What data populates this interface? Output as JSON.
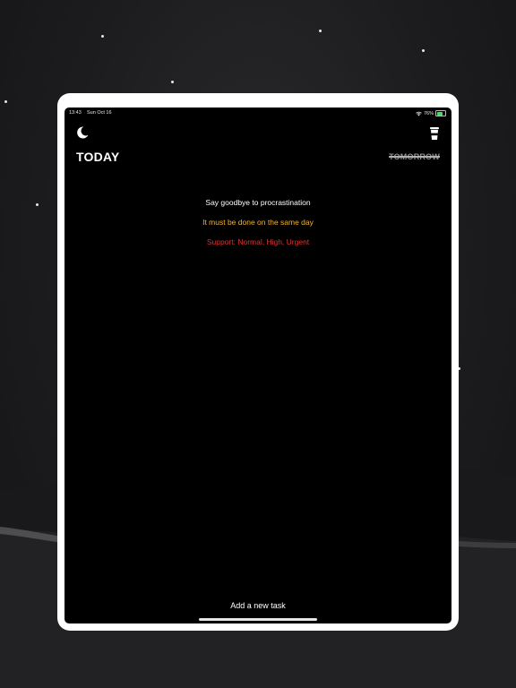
{
  "status_bar": {
    "time": "13:43",
    "date": "Sun Oct 16",
    "battery_percent": "76%",
    "battery_level": 0.76,
    "wifi_icon": "wifi-icon",
    "battery_icon": "battery-icon"
  },
  "toolbar": {
    "left_icon": "moon-icon",
    "right_icon": "coffee-cup-icon"
  },
  "tabs": {
    "today": "TODAY",
    "tomorrow": "TOMORROW"
  },
  "tips": {
    "line1": "Say goodbye to procrastination",
    "line2": "It must be done on the same day",
    "line3": "Support: Normal, High, Urgent"
  },
  "footer": {
    "add_task": "Add a new task"
  },
  "colors": {
    "screen_background": "#000000",
    "text_primary": "#ffffff",
    "tip_yellow": "#f2b430",
    "tip_red": "#e0322f",
    "tab_inactive": "#8e8e93",
    "device_frame": "#ffffff",
    "battery_green": "#4cd964"
  }
}
